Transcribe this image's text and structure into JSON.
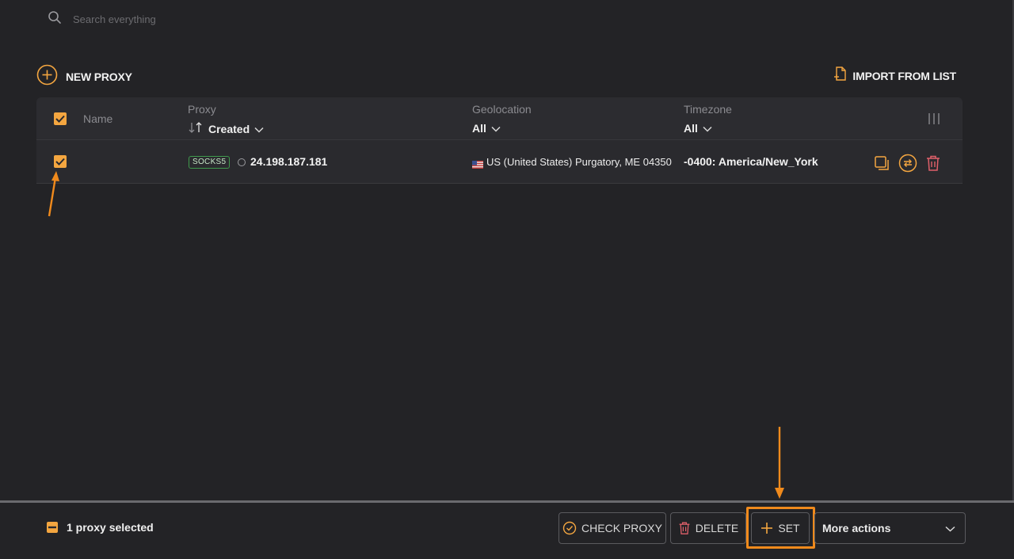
{
  "search": {
    "placeholder": "Search everything"
  },
  "toolbar": {
    "new_proxy_label": "NEW PROXY",
    "import_label": "IMPORT FROM LIST"
  },
  "table": {
    "headers": {
      "name": "Name",
      "proxy": "Proxy",
      "proxy_sort": "Created",
      "geolocation": "Geolocation",
      "geolocation_filter": "All",
      "timezone": "Timezone",
      "timezone_filter": "All"
    },
    "rows": [
      {
        "selected": true,
        "type": "SOCKS5",
        "ip": "24.198.187.181",
        "geo": "US (United States) Purgatory, ME 04350",
        "timezone": "-0400: America/New_York"
      }
    ]
  },
  "footer": {
    "selected_text": "1 proxy selected",
    "check_label": "CHECK PROXY",
    "delete_label": "DELETE",
    "set_label": "SET",
    "more_label": "More actions"
  },
  "colors": {
    "accent": "#f4a640",
    "highlight": "#f08a1c",
    "danger": "#e0606a",
    "socks_badge": "#3f9a4c",
    "background": "#232326"
  },
  "icons": [
    "search-icon",
    "plus-circle-icon",
    "import-file-icon",
    "check-icon",
    "sort-icon",
    "chevron-down-icon",
    "columns-icon",
    "status-dot-icon",
    "us-flag-icon",
    "copy-icon",
    "swap-icon",
    "trash-icon",
    "check-circle-icon",
    "plus-icon",
    "minus-icon"
  ]
}
